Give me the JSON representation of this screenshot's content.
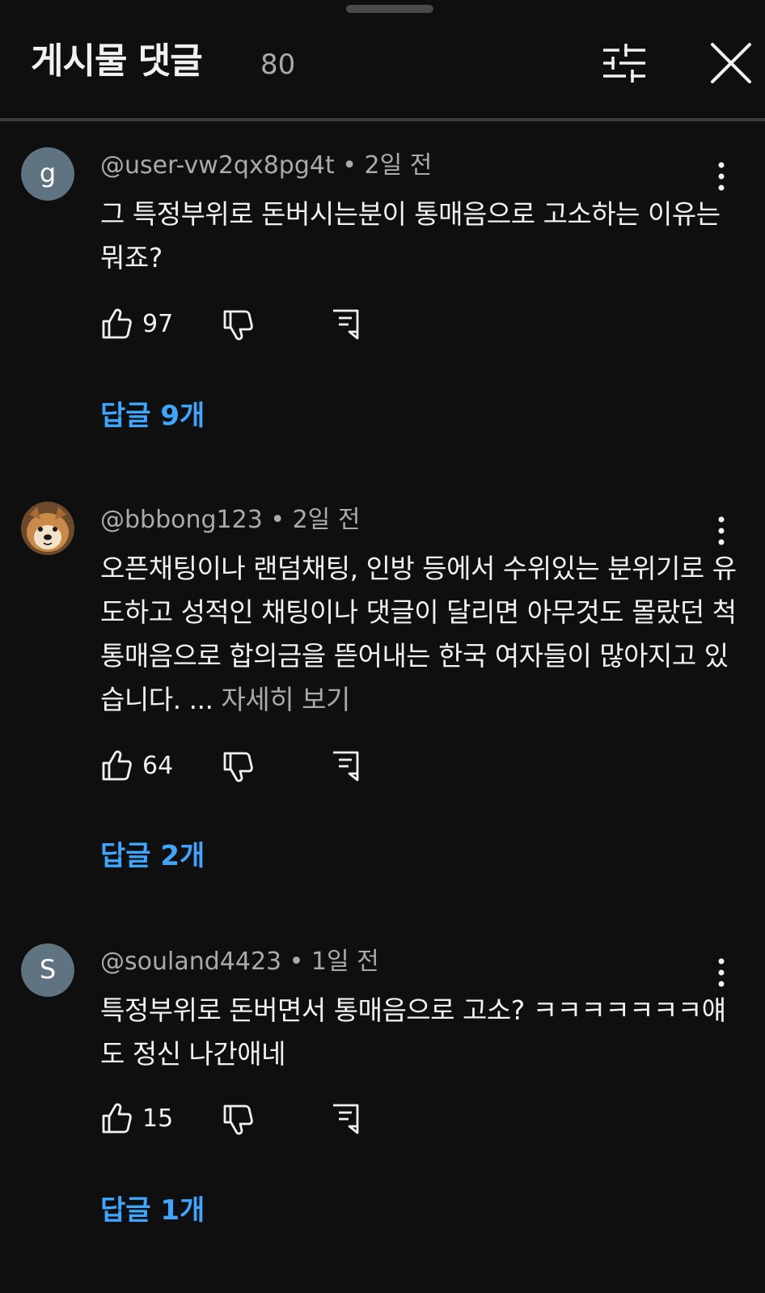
{
  "header": {
    "title": "게시물 댓글",
    "count": "80"
  },
  "comments": [
    {
      "avatar_letter": "g",
      "author": "@user-vw2qx8pg4t",
      "time": "2일 전",
      "text": "그 특정부위로 돈버시는분이 통매음으로 고소하는 이유는 뭐죠?",
      "more_label": "",
      "likes": "97",
      "replies_label": "답글 9개"
    },
    {
      "avatar_letter": "",
      "author": "@bbbong123",
      "time": "2일 전",
      "text": "오픈채팅이나 랜덤채팅, 인방 등에서 수위있는 분위기로 유도하고 성적인 채팅이나 댓글이 달리면 아무것도 몰랐던 척 통매음으로 합의금을 뜯어내는 한국 여자들이 많아지고 있습니다. ... ",
      "more_label": "자세히 보기",
      "likes": "64",
      "replies_label": "답글 2개"
    },
    {
      "avatar_letter": "S",
      "author": "@souland4423",
      "time": "1일 전",
      "text": "특정부위로 돈버면서 통매음으로 고소? ㅋㅋㅋㅋㅋㅋㅋ얘도 정신 나간애네",
      "more_label": "",
      "likes": "15",
      "replies_label": "답글 1개"
    }
  ],
  "separator": " • ",
  "icons": {
    "filter": "sliders-icon",
    "close": "close-icon",
    "more": "more-vert-icon",
    "like": "thumb-up-icon",
    "dislike": "thumb-down-icon",
    "reply": "reply-icon"
  },
  "colors": {
    "background": "#0f0f0f",
    "text": "#f1f1f1",
    "secondary": "#aaaaaa",
    "link": "#3ea6ff"
  }
}
